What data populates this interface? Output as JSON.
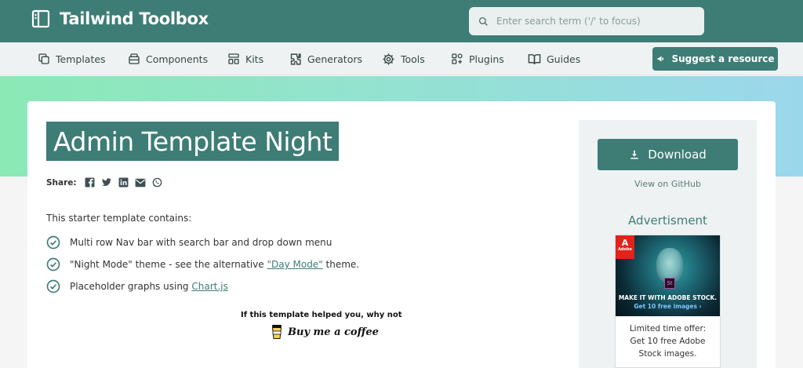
{
  "header": {
    "brand": "Tailwind Toolbox",
    "search_placeholder": "Enter search term ('/' to focus)"
  },
  "nav": {
    "items": [
      {
        "label": "Templates",
        "icon": "templates-icon"
      },
      {
        "label": "Components",
        "icon": "components-icon"
      },
      {
        "label": "Kits",
        "icon": "kits-icon"
      },
      {
        "label": "Generators",
        "icon": "generators-icon"
      },
      {
        "label": "Tools",
        "icon": "tools-icon"
      },
      {
        "label": "Plugins",
        "icon": "plugins-icon"
      },
      {
        "label": "Guides",
        "icon": "guides-icon"
      }
    ],
    "suggest_label": "Suggest a resource"
  },
  "page": {
    "title": "Admin Template Night",
    "share_label": "Share:",
    "intro": "This starter template contains:",
    "features": {
      "f1": "Multi row Nav bar with search bar and drop down menu",
      "f2_prefix": "\"Night Mode\" theme - see the alternative ",
      "f2_link": "\"Day Mode\"",
      "f2_suffix": " theme.",
      "f3_prefix": "Placeholder graphs using ",
      "f3_link": "Chart.js"
    },
    "coffee_prompt": "If this template helped you, why not",
    "coffee_label": "Buy me a coffee"
  },
  "sidebar": {
    "download_label": "Download",
    "github_label": "View on GitHub",
    "ad_title": "Advertisment",
    "ad": {
      "logo_text": "Adobe",
      "st_text": "St",
      "headline": "MAKE IT WITH ADOBE STOCK.",
      "subline": "Get 10 free images ›",
      "copy": "Limited time offer: Get 10 free Adobe Stock images."
    }
  },
  "colors": {
    "brand": "#3d7d76",
    "nav_bg": "#eef2f2",
    "gradient_start": "#8be9b6",
    "gradient_end": "#9bd7ec"
  }
}
